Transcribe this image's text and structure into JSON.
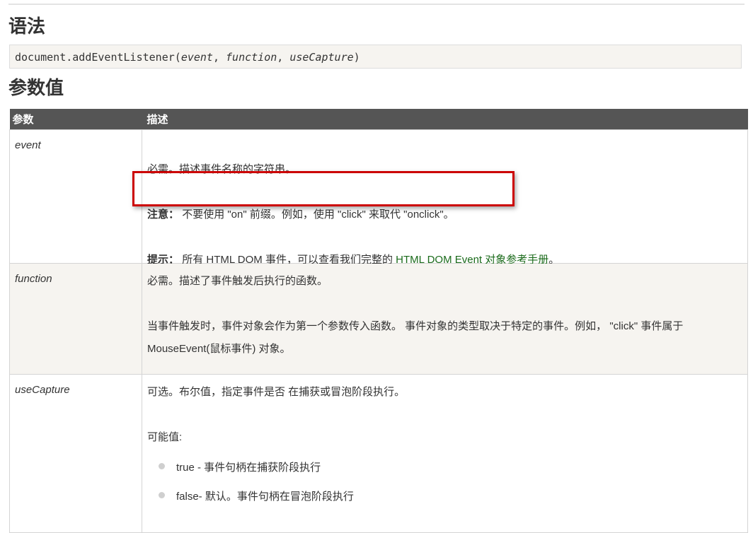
{
  "syntax": {
    "heading": "语法",
    "code_prefix": "document.addEventListener(",
    "arg1": "event",
    "sep1": ", ",
    "arg2": "function",
    "sep2": ", ",
    "arg3": "useCapture",
    "code_suffix": ")"
  },
  "params": {
    "heading": "参数值",
    "col_param": "参数",
    "col_desc": "描述",
    "rows": [
      {
        "name": "event",
        "line1": "必需。描述事件名称的字符串。",
        "note_label": "注意：",
        "note_text": "不要使用 \"on\" 前缀。例如，使用 \"click\" 来取代 \"onclick\"。",
        "tip_label": "提示：",
        "tip_text": "所有 HTML DOM 事件，可以查看我们完整的 ",
        "tip_link": "HTML DOM Event 对象参考手册",
        "tip_end": "。"
      },
      {
        "name": "function",
        "line1": "必需。描述了事件触发后执行的函数。",
        "line2": "当事件触发时，事件对象会作为第一个参数传入函数。 事件对象的类型取决于特定的事件。例如， \"click\" 事件属于",
        "line3": "MouseEvent(鼠标事件) 对象。"
      },
      {
        "name": "useCapture",
        "line1": "可选。布尔值，指定事件是否 在捕获或冒泡阶段执行。",
        "possible": "可能值:",
        "opt1": "true - 事件句柄在捕获阶段执行",
        "opt2": "false- 默认。事件句柄在冒泡阶段执行"
      }
    ]
  },
  "colors": {
    "header_bg": "#555555",
    "alt_row_bg": "#f6f4f0",
    "highlight_border": "#cc0000",
    "link": "#1b6b1b"
  }
}
